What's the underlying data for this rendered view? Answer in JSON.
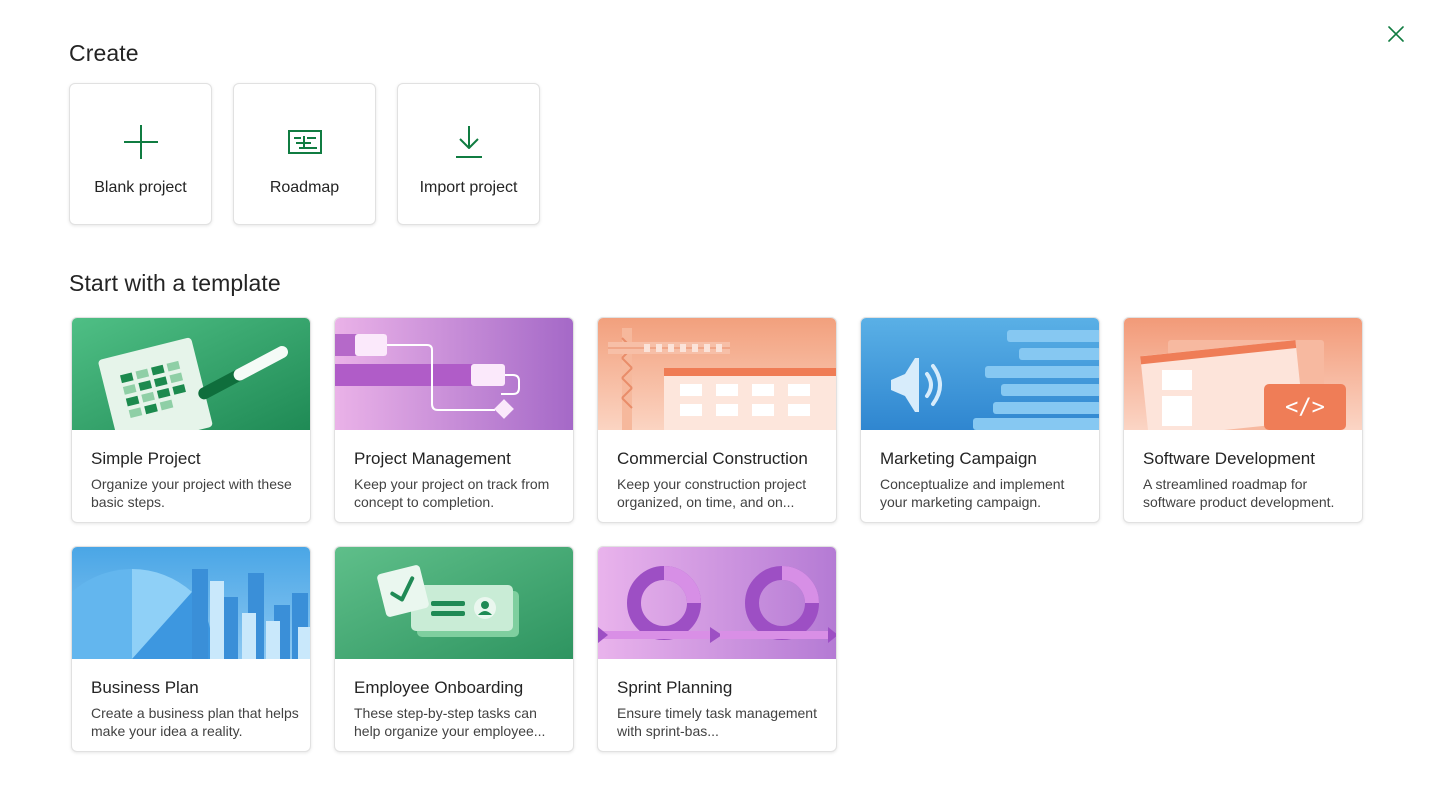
{
  "close": {
    "icon": "close-icon"
  },
  "create": {
    "title": "Create",
    "items": [
      {
        "label": "Blank project",
        "icon": "plus-icon"
      },
      {
        "label": "Roadmap",
        "icon": "roadmap-icon"
      },
      {
        "label": "Import project",
        "icon": "download-icon"
      }
    ]
  },
  "templates": {
    "title": "Start with a template",
    "items": [
      {
        "name": "Simple Project",
        "desc": "Organize your project with these basic steps."
      },
      {
        "name": "Project Management",
        "desc": "Keep your project on track from concept to completion."
      },
      {
        "name": "Commercial Construction",
        "desc": "Keep your construction project organized, on time, and on..."
      },
      {
        "name": "Marketing Campaign",
        "desc": "Conceptualize and implement your marketing campaign."
      },
      {
        "name": "Software Development",
        "desc": "A streamlined roadmap for software product development."
      },
      {
        "name": "Business Plan",
        "desc": "Create a business plan that helps make your idea a reality."
      },
      {
        "name": "Employee Onboarding",
        "desc": "These step-by-step tasks can help organize your employee..."
      },
      {
        "name": "Sprint Planning",
        "desc": "Ensure timely task management with sprint-bas..."
      }
    ]
  },
  "colors": {
    "accent": "#107c41",
    "text": "#242424",
    "subtext": "#424242"
  }
}
